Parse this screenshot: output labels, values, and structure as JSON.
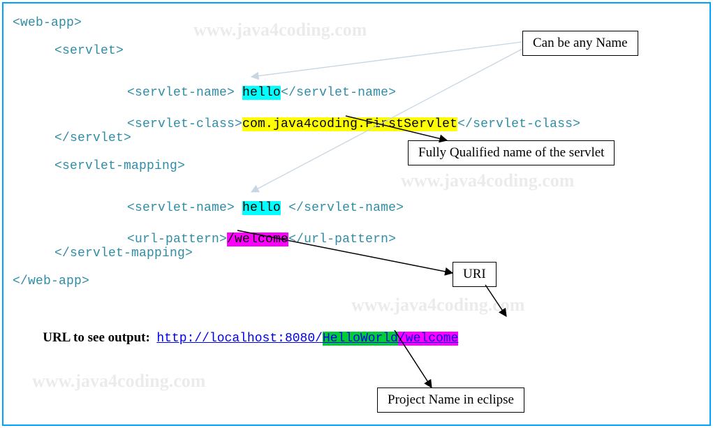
{
  "watermark": "www.java4coding.com",
  "code": {
    "l1": "<web-app>",
    "l2": "<servlet>",
    "l3a": "<servlet-name> ",
    "l3b": "hello",
    "l3c": "</servlet-name>",
    "l4a": "<servlet-class>",
    "l4b": "com.java4coding.FirstServlet",
    "l4c": "</servlet-class>",
    "l5": "</servlet>",
    "l6": "<servlet-mapping>",
    "l7a": "<servlet-name> ",
    "l7b": "hello",
    "l7c": " </servlet-name>",
    "l8a": "<url-pattern>",
    "l8b": "/welcome",
    "l8c": "</url-pattern>",
    "l9": "</servlet-mapping>",
    "l10": "</web-app>"
  },
  "url": {
    "label": "URL to see output:  ",
    "base": "http://localhost:8080/",
    "project": "HelloWorld",
    "pattern": "/welcome"
  },
  "callouts": {
    "anyName": "Can be any Name",
    "fqn": "Fully Qualified name of the servlet",
    "uri": "URI",
    "project": "Project Name in eclipse"
  }
}
